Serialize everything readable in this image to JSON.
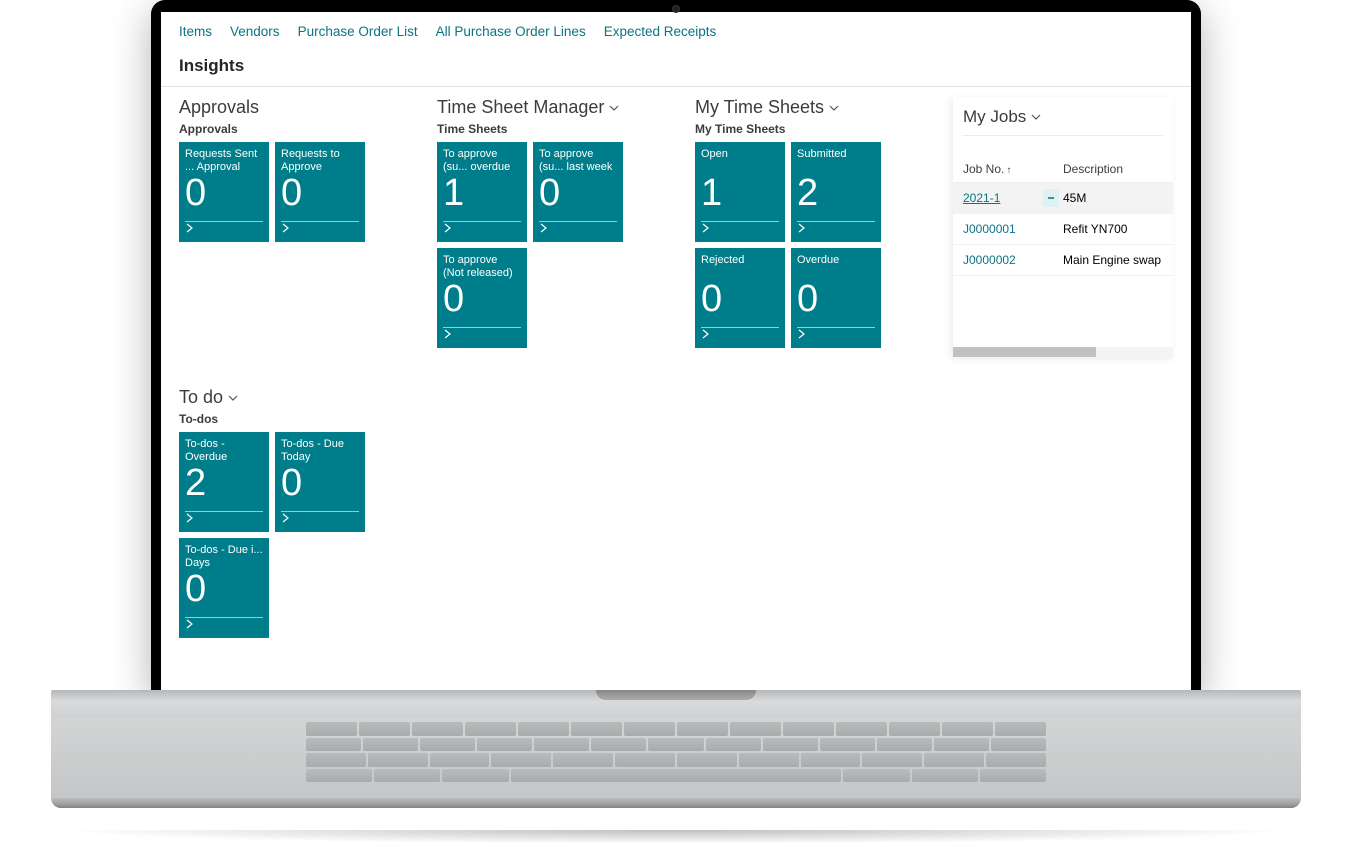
{
  "nav": {
    "items": [
      "Items",
      "Vendors",
      "Purchase Order List",
      "All Purchase Order Lines",
      "Expected Receipts"
    ]
  },
  "insights_title": "Insights",
  "sections": {
    "approvals": {
      "title": "Approvals",
      "subtitle": "Approvals",
      "tiles": [
        {
          "label": "Requests Sent ... Approval",
          "value": "0"
        },
        {
          "label": "Requests to Approve",
          "value": "0"
        }
      ]
    },
    "tsm": {
      "title": "Time Sheet Manager",
      "subtitle": "Time Sheets",
      "tiles": [
        {
          "label": "To approve (su... overdue",
          "value": "1"
        },
        {
          "label": "To approve (su... last week",
          "value": "0"
        },
        {
          "label": "To approve (Not released)",
          "value": "0"
        }
      ]
    },
    "mts": {
      "title": "My Time Sheets",
      "subtitle": "My Time Sheets",
      "tiles": [
        {
          "label": "Open",
          "value": "1"
        },
        {
          "label": "Submitted",
          "value": "2"
        },
        {
          "label": "Rejected",
          "value": "0"
        },
        {
          "label": "Overdue",
          "value": "0"
        }
      ]
    },
    "todo": {
      "title": "To do",
      "subtitle": "To-dos",
      "tiles": [
        {
          "label": "To-dos - Overdue",
          "value": "2"
        },
        {
          "label": "To-dos - Due Today",
          "value": "0"
        },
        {
          "label": "To-dos - Due i... Days",
          "value": "0"
        }
      ]
    }
  },
  "jobs": {
    "title": "My Jobs",
    "columns": {
      "jobno": "Job No.",
      "description": "Description"
    },
    "rows": [
      {
        "no": "2021-1",
        "desc": "45M",
        "selected": true,
        "underline": true
      },
      {
        "no": "J0000001",
        "desc": "Refit YN700",
        "selected": false,
        "underline": false
      },
      {
        "no": "J0000002",
        "desc": "Main Engine swap",
        "selected": false,
        "underline": false
      }
    ]
  }
}
